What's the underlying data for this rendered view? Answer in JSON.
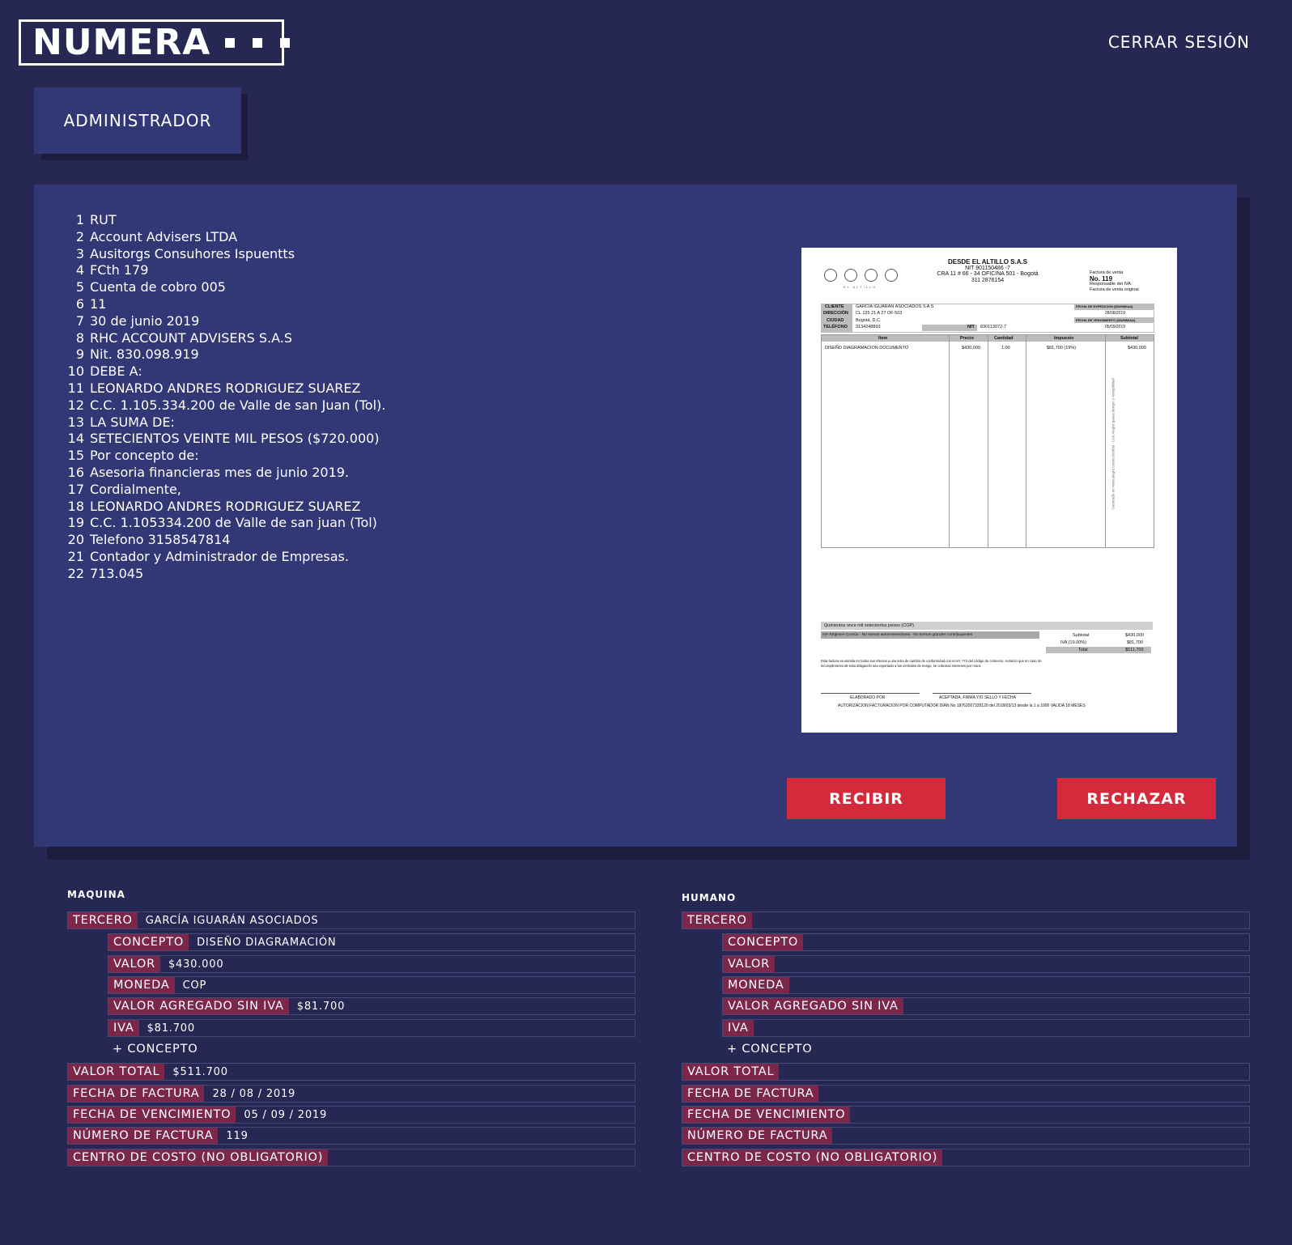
{
  "header": {
    "logo": "NUMERA",
    "logout": "CERRAR SESIÓN"
  },
  "role": "ADMINISTRADOR",
  "ocr_lines": [
    {
      "n": "1",
      "text": "RUT"
    },
    {
      "n": "2",
      "text": "Account Advisers LTDA"
    },
    {
      "n": "3",
      "text": "Ausitorgs Consuhores Ispuentts"
    },
    {
      "n": "4",
      "text": "FCth 179"
    },
    {
      "n": "5",
      "text": "Cuenta de cobro 005"
    },
    {
      "n": "6",
      "text": "11"
    },
    {
      "n": "7",
      "text": "30 de junio 2019"
    },
    {
      "n": "8",
      "text": "RHC ACCOUNT ADVISERS S.A.S"
    },
    {
      "n": "9",
      "text": "Nit. 830.098.919"
    },
    {
      "n": "10",
      "text": "DEBE A:"
    },
    {
      "n": "11",
      "text": "LEONARDO ANDRES RODRIGUEZ SUAREZ"
    },
    {
      "n": "12",
      "text": "C.C. 1.105.334.200 de Valle de san Juan (Tol)."
    },
    {
      "n": "13",
      "text": "LA SUMA DE:"
    },
    {
      "n": "14",
      "text": "SETECIENTOS VEINTE MIL PESOS ($720.000)"
    },
    {
      "n": "15",
      "text": "Por concepto de:"
    },
    {
      "n": "16",
      "text": "Asesoria financieras mes de junio 2019."
    },
    {
      "n": "17",
      "text": "Cordialmente,"
    },
    {
      "n": "18",
      "text": "LEONARDO ANDRES RODRIGUEZ SUAREZ"
    },
    {
      "n": "19",
      "text": "C.C. 1.105334.200 de Valle de san juan (Tol)"
    },
    {
      "n": "20",
      "text": "Telefono 3158547814"
    },
    {
      "n": "21",
      "text": "Contador y Administrador de Empresas."
    },
    {
      "n": "22",
      "text": "713.045"
    }
  ],
  "invoice": {
    "company": "DESDE EL ALTILLO S.A.S",
    "nit": "NIT 901150486 -7",
    "address": "CRA 11 # 66 - 34 OFICINA 501 - Bogotá",
    "phone": "311 2876154",
    "logo_caption": "EL ALTILLO",
    "type": "Factura de venta",
    "number": "No. 119",
    "iva_resp": "Responsable del IVA",
    "original": "Factura de venta original",
    "lbl_cliente": "CLIENTE",
    "lbl_direccion": "DIRECCIÓN",
    "lbl_ciudad": "CIUDAD",
    "lbl_telefono": "TELÉFONO",
    "lbl_nit": "NIT",
    "lbl_expedicion": "FECHA DE EXPEDICIÓN (DD/MM/AA)",
    "lbl_vencimiento": "FECHA DE VENCIMIENTO (DD/MM/AA)",
    "cliente": "GARCIA IGUARAN ASOCIADOS S A S",
    "direccion": "CL 125 21 A 27 OF 503",
    "ciudad": "Bogotá, D.C.",
    "telefono": "3134248893",
    "nit_cliente": "830113072-7",
    "fecha_expedicion": "28/08/2019",
    "fecha_vencimiento": "05/09/2019",
    "headers": [
      "Item",
      "Precio",
      "Cantidad",
      "Impuesto",
      "Subtotal"
    ],
    "item": {
      "desc": "DISEÑO DIAGRAMACION DOCUMENTO",
      "precio": "$430,000",
      "cantidad": "1.00",
      "impuesto": "$81,700 (19%)",
      "subtotal": "$430,000"
    },
    "side_note": "Generado en www.alegra.com/colombia - Con Alegra ganas tiempo y tranquilidad",
    "words": "Quinientos once mil setecientos pesos (COP)",
    "regimen": "IVA Régimen Común - No somos autorretenedores - No somos grandes contribuyentes",
    "lbl_subtotal": "Subtotal",
    "subtotal": "$430,000",
    "lbl_iva": "IVA (19.00%)",
    "iva": "$81,700",
    "lbl_total": "Total",
    "total": "$511,700",
    "legal": "Esta factura se asimila en todos sus efectos a una letra de cambio de conformidad con el Art. 774 del código de comercio. Autorizo que en caso de incumplimiento de esta obligación sea reportado a las centrales de riesgo, se cobraran intereses por mora.",
    "elaborado": "ELABORADO POR",
    "aceptada": "ACEPTADA, FIRMA Y/O SELLO Y FECHA",
    "autorizacion": "AUTORIZACION FACTURACION POR COMPUTADOR DIAN No 18762007339120 del 2018/03/13 desde la 1 a 1000 VALIDA 18 MESES"
  },
  "buttons": {
    "receive": "RECIBIR",
    "reject": "RECHAZAR"
  },
  "machine": {
    "title": "MAQUINA",
    "tercero_label": "TERCERO",
    "tercero": "GARCÍA IGUARÁN ASOCIADOS",
    "concepto_label": "CONCEPTO",
    "concepto": "DISEÑO DIAGRAMACIÓN",
    "valor_label": "VALOR",
    "valor": "$430.000",
    "moneda_label": "MONEDA",
    "moneda": "COP",
    "vasi_label": "VALOR AGREGADO SIN IVA",
    "vasi": "$81.700",
    "iva_label": "IVA",
    "iva": "$81.700",
    "add_concept": "+ CONCEPTO",
    "total_label": "VALOR TOTAL",
    "total": "$511.700",
    "fecha_label": "FECHA DE FACTURA",
    "fecha": "28 / 08 / 2019",
    "venc_label": "FECHA DE VENCIMIENTO",
    "venc": "05 / 09 / 2019",
    "num_label": "NÚMERO DE FACTURA",
    "num": "119",
    "centro_label": "CENTRO DE COSTO (NO OBLIGATORIO)",
    "centro": ""
  },
  "human": {
    "title": "HUMANO",
    "tercero_label": "TERCERO",
    "tercero": "",
    "concepto_label": "CONCEPTO",
    "concepto": "",
    "valor_label": "VALOR",
    "valor": "",
    "moneda_label": "MONEDA",
    "moneda": "",
    "vasi_label": "VALOR AGREGADO SIN IVA",
    "vasi": "",
    "iva_label": "IVA",
    "iva": "",
    "add_concept": "+ CONCEPTO",
    "total_label": "VALOR TOTAL",
    "total": "",
    "fecha_label": "FECHA DE FACTURA",
    "fecha": "",
    "venc_label": "FECHA DE VENCIMIENTO",
    "venc": "",
    "num_label": "NÚMERO DE FACTURA",
    "num": "",
    "centro_label": "CENTRO DE COSTO (NO OBLIGATORIO)",
    "centro": ""
  }
}
